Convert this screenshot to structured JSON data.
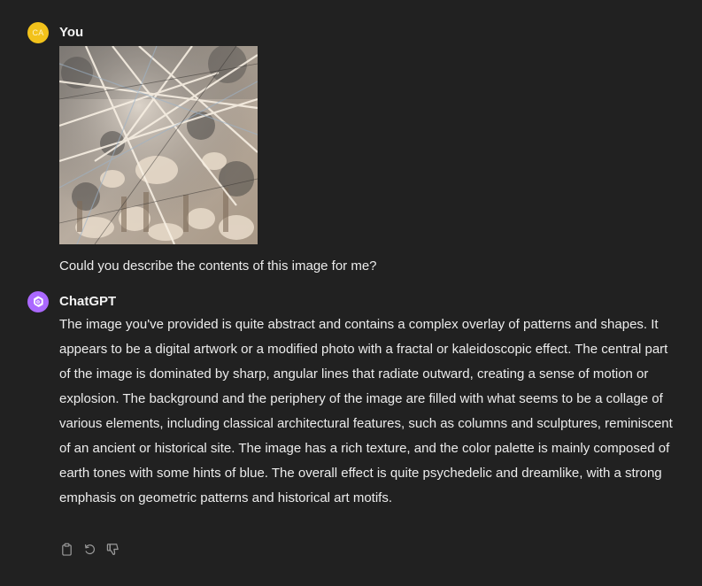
{
  "user_message": {
    "avatar_initials": "CA",
    "avatar_color": "#f2c21b",
    "author": "You",
    "text": "Could you describe the contents of this image for me?"
  },
  "assistant_message": {
    "avatar_icon": "openai-logo-icon",
    "avatar_color": "#ab68ff",
    "author": "ChatGPT",
    "text": "The image you've provided is quite abstract and contains a complex overlay of patterns and shapes. It appears to be a digital artwork or a modified photo with a fractal or kaleidoscopic effect. The central part of the image is dominated by sharp, angular lines that radiate outward, creating a sense of motion or explosion. The background and the periphery of the image are filled with what seems to be a collage of various elements, including classical architectural features, such as columns and sculptures, reminiscent of an ancient or historical site. The image has a rich texture, and the color palette is mainly composed of earth tones with some hints of blue. The overall effect is quite psychedelic and dreamlike, with a strong emphasis on geometric patterns and historical art motifs.",
    "actions": [
      {
        "icon": "copy-icon"
      },
      {
        "icon": "regenerate-icon"
      },
      {
        "icon": "thumbs-down-icon"
      }
    ]
  },
  "colors": {
    "background": "#212121",
    "text": "#ececec",
    "icon": "#9b9b9b"
  }
}
